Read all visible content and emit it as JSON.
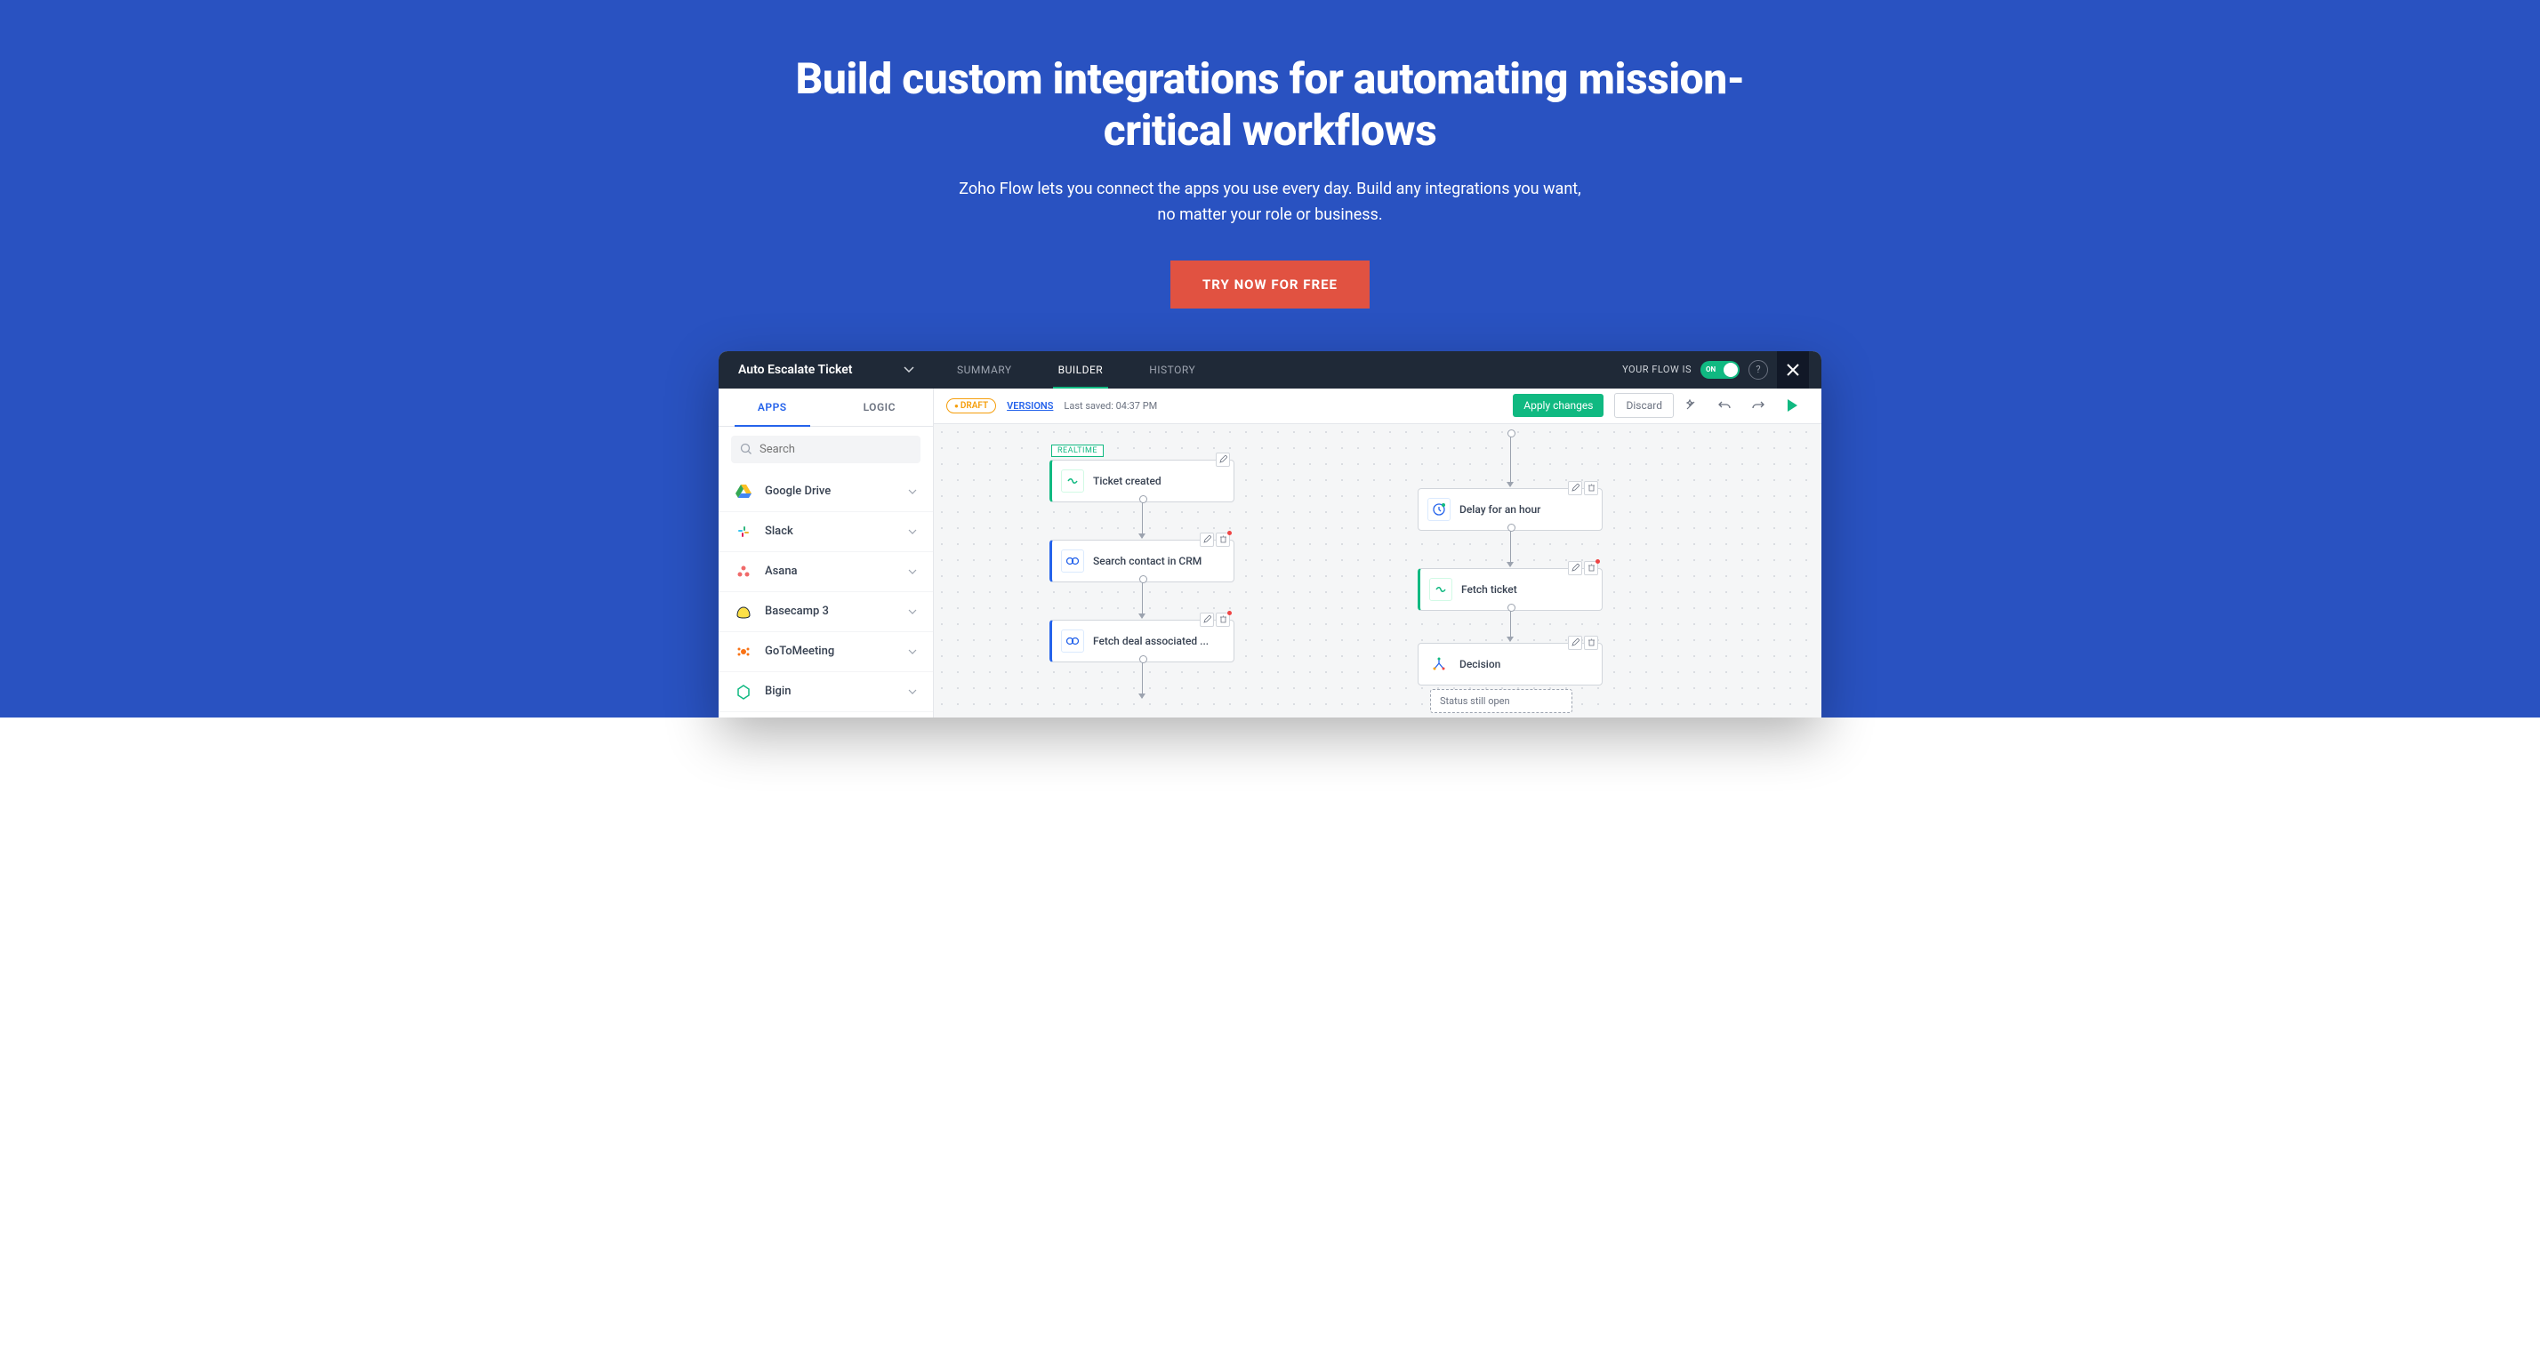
{
  "hero": {
    "title": "Build custom integrations for automating mission-critical workflows",
    "subtitle_line1": "Zoho Flow lets you connect the apps you use every day. Build any integrations you want,",
    "subtitle_line2": "no matter your role or business.",
    "cta": "TRY NOW FOR FREE"
  },
  "app_header": {
    "flow_name": "Auto Escalate Ticket",
    "tabs": [
      "SUMMARY",
      "BUILDER",
      "HISTORY"
    ],
    "active_tab": "BUILDER",
    "status_label": "YOUR FLOW IS",
    "toggle_state": "ON"
  },
  "toolbar": {
    "draft": "DRAFT",
    "versions": "VERSIONS",
    "last_saved": "Last saved: 04:37 PM",
    "apply": "Apply changes",
    "discard": "Discard"
  },
  "sidebar": {
    "tabs": [
      "APPS",
      "LOGIC"
    ],
    "active_tab": "APPS",
    "search_placeholder": "Search",
    "apps": [
      {
        "name": "Google Drive",
        "icon_color": "#fbbf24"
      },
      {
        "name": "Slack",
        "icon_color": "#e11d48"
      },
      {
        "name": "Asana",
        "icon_color": "#f87171"
      },
      {
        "name": "Basecamp 3",
        "icon_color": "#facc15"
      },
      {
        "name": "GoToMeeting",
        "icon_color": "#f97316"
      },
      {
        "name": "Bigin",
        "icon_color": "#10b981"
      }
    ]
  },
  "canvas": {
    "realtime_tag": "REALTIME",
    "left_branch": [
      {
        "label": "Ticket created",
        "accent": "green"
      },
      {
        "label": "Search contact in CRM",
        "accent": "blue"
      },
      {
        "label": "Fetch deal associated ...",
        "accent": "blue"
      }
    ],
    "right_branch": [
      {
        "label": "Delay for an hour",
        "accent": "white",
        "icon": "clock"
      },
      {
        "label": "Fetch ticket",
        "accent": "green"
      },
      {
        "label": "Decision",
        "accent": "white",
        "icon": "decision"
      }
    ],
    "sub_node": "Status still open"
  }
}
